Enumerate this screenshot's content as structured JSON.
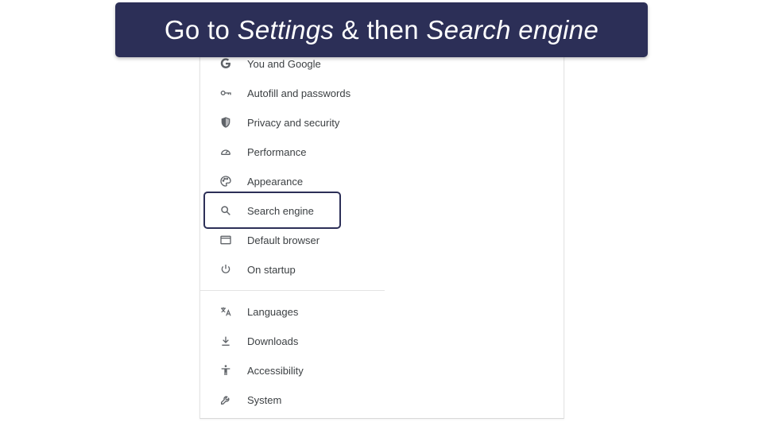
{
  "banner": {
    "part1": "Go to ",
    "part2": "Settings",
    "part3": " & then ",
    "part4": "Search engine"
  },
  "menu": {
    "items": [
      {
        "label": "You and Google",
        "icon": "google-g-icon"
      },
      {
        "label": "Autofill and passwords",
        "icon": "key-icon"
      },
      {
        "label": "Privacy and security",
        "icon": "shield-icon"
      },
      {
        "label": "Performance",
        "icon": "gauge-icon"
      },
      {
        "label": "Appearance",
        "icon": "palette-icon"
      },
      {
        "label": "Search engine",
        "icon": "search-icon"
      },
      {
        "label": "Default browser",
        "icon": "browser-window-icon"
      },
      {
        "label": "On startup",
        "icon": "power-icon"
      },
      {
        "label": "Languages",
        "icon": "translate-icon"
      },
      {
        "label": "Downloads",
        "icon": "download-icon"
      },
      {
        "label": "Accessibility",
        "icon": "accessibility-icon"
      },
      {
        "label": "System",
        "icon": "wrench-icon"
      }
    ],
    "highlighted": "Search engine"
  },
  "colors": {
    "banner_bg": "#2c2f57",
    "banner_text": "#ffffff",
    "highlight_border": "#2c2f57",
    "menu_text": "#3c4043",
    "icon": "#5f6368"
  }
}
